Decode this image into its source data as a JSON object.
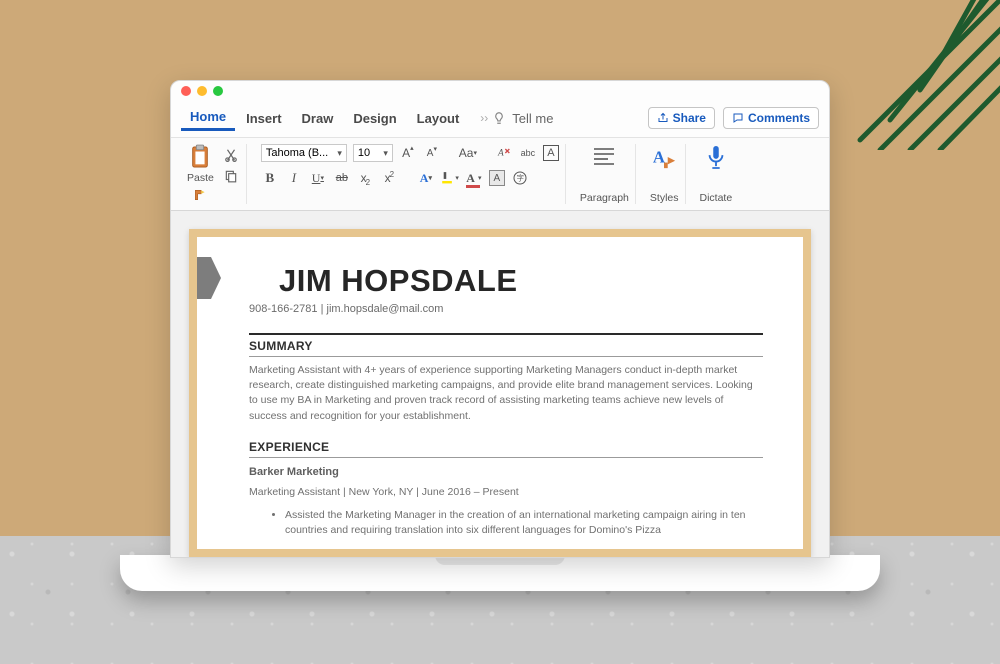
{
  "tabs": {
    "home": "Home",
    "insert": "Insert",
    "draw": "Draw",
    "design": "Design",
    "layout": "Layout",
    "tell_me": "Tell me"
  },
  "header_buttons": {
    "share": "Share",
    "comments": "Comments"
  },
  "ribbon": {
    "paste": "Paste",
    "font_name": "Tahoma (B...",
    "font_size": "10",
    "paragraph": "Paragraph",
    "styles": "Styles",
    "dictate": "Dictate"
  },
  "resume": {
    "name": "JIM HOPSDALE",
    "phone": "908-166-2781",
    "email": "jim.hopsdale@mail.com",
    "summary_label": "SUMMARY",
    "summary_text": "Marketing Assistant with 4+ years of experience supporting Marketing Managers conduct in-depth market research, create distinguished marketing campaigns, and provide elite brand management services. Looking to use my BA in Marketing and proven track record of assisting marketing teams achieve new levels of success and recognition for your establishment.",
    "experience_label": "EXPERIENCE",
    "exp_company": "Barker Marketing",
    "exp_title": "Marketing Assistant",
    "exp_location": "New York, NY",
    "exp_dates": "June 2016 – Present",
    "exp_bullet_1": "Assisted the Marketing Manager in the creation of an international marketing campaign airing in ten countries and requiring translation into six different languages for Domino's Pizza"
  }
}
